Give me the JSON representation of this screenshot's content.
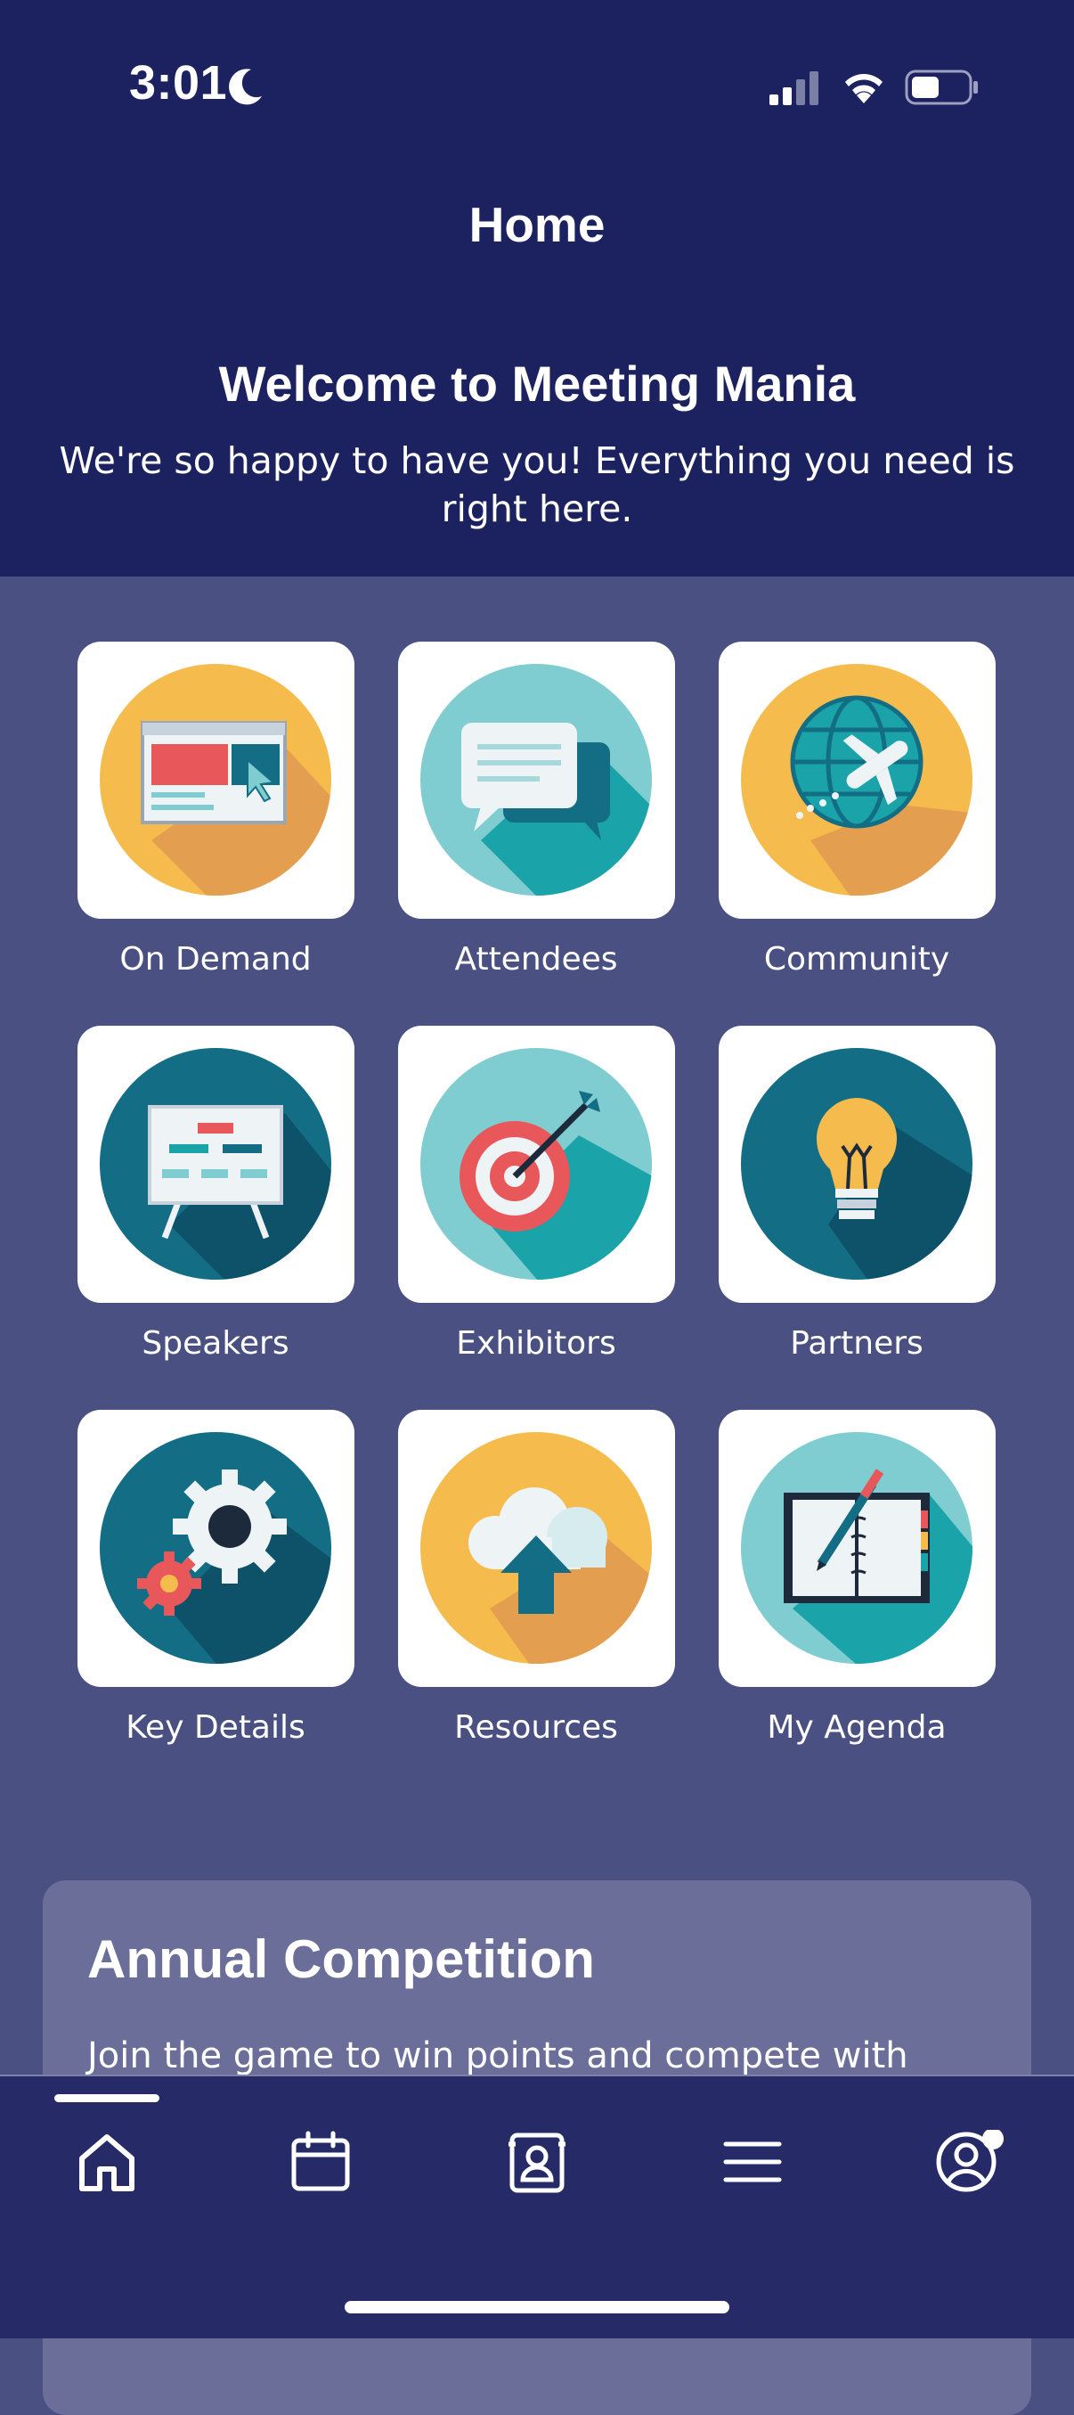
{
  "status_bar": {
    "time": "3:01"
  },
  "header": {
    "title": "Home",
    "welcome_title": "Welcome to Meeting Mania",
    "welcome_subtitle": "We're so happy to have you! Everything you need is right here."
  },
  "tiles": [
    {
      "label": "On Demand",
      "icon": "browser-window-icon"
    },
    {
      "label": "Attendees",
      "icon": "chat-bubbles-icon"
    },
    {
      "label": "Community",
      "icon": "globe-airplane-icon"
    },
    {
      "label": "Speakers",
      "icon": "presentation-board-icon"
    },
    {
      "label": "Exhibitors",
      "icon": "target-dart-icon"
    },
    {
      "label": "Partners",
      "icon": "lightbulb-icon"
    },
    {
      "label": "Key Details",
      "icon": "gears-icon"
    },
    {
      "label": "Resources",
      "icon": "cloud-upload-icon"
    },
    {
      "label": "My Agenda",
      "icon": "notebook-pen-icon"
    }
  ],
  "card": {
    "title": "Annual Competition",
    "text": "Join the game to win points and compete with"
  },
  "tabbar": {
    "items": [
      "home-icon",
      "calendar-icon",
      "contacts-icon",
      "menu-icon",
      "profile-icon"
    ],
    "active": "home-icon"
  },
  "colors": {
    "header_bg": "#1c2260",
    "body_bg": "#4a5081",
    "card_bg": "#6a6e99",
    "tabbar_bg": "#262b67",
    "yellow": "#f6bb4d",
    "teal": "#1aa3a9",
    "dark_teal": "#136d84",
    "light_teal": "#7fcdd0"
  }
}
